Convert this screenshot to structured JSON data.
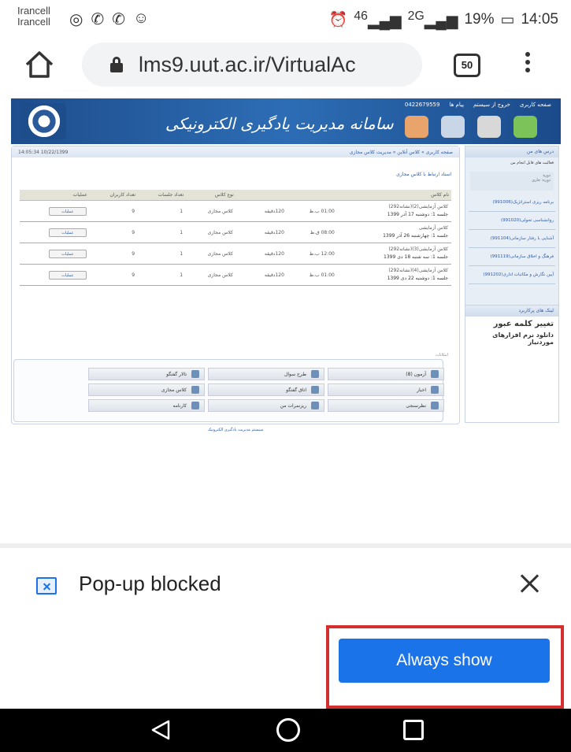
{
  "statusbar": {
    "carrier1": "Irancell",
    "carrier2": "Irancell",
    "signal1": "46",
    "signal2": "2G",
    "battery": "19%",
    "time": "14:05",
    "icons": [
      "instagram-icon",
      "whatsapp-icon",
      "viber-icon",
      "messenger-icon",
      "alarm-icon",
      "battery-icon"
    ]
  },
  "browser": {
    "url": "lms9.uut.ac.ir/VirtualAc",
    "tab_count": "50"
  },
  "site": {
    "banner_title": "سامانه مدیریت یادگیری الکترونیکی",
    "top_nav": [
      "صفحه کاربری",
      "خروج از سیستم",
      "پیام ها",
      "0422679559"
    ],
    "datetime": "14:05:34 10/22/1399",
    "breadcrumb": "صفحه کاربری » کلاس آنلاین » مدیریت کلاس مجازی",
    "related_link": "اسناد ارتباط با کلاس مجازی",
    "table": {
      "headers": [
        "نام کلاس",
        "",
        "",
        "",
        "نوع کلاس",
        "تعداد جلسات",
        "تعداد کاربران",
        "عملیات"
      ],
      "rows": [
        {
          "name": "کلاس آزمایشی(2)(نشانه292)",
          "session": "جلسه 1: دوشنبه 17 آذر 1399",
          "time": "01:00 ب.ظ",
          "duration": "120دقیقه",
          "type": "کلاس مجازی",
          "sessions": "1",
          "users": "9",
          "action": "عملیات"
        },
        {
          "name": "کلاس آزمایشی",
          "session": "جلسه 1: چهارشنبه 26 آذر 1399",
          "time": "08:00 ق.ظ",
          "duration": "120دقیقه",
          "type": "کلاس مجازی",
          "sessions": "1",
          "users": "9",
          "action": "عملیات"
        },
        {
          "name": "کلاس آزمایشی(3)(نشانه292)",
          "session": "جلسه 1: سه شنبه 18 دی 1399",
          "time": "12:00 ب.ظ",
          "duration": "120دقیقه",
          "type": "کلاس مجازی",
          "sessions": "1",
          "users": "9",
          "action": "عملیات"
        },
        {
          "name": "کلاس آزمایشی(4)(نشانه292)",
          "session": "جلسه 1: دوشنبه 22 دی 1399",
          "time": "01:00 ب.ظ",
          "duration": "120دقیقه",
          "type": "کلاس مجازی",
          "sessions": "1",
          "users": "9",
          "action": "عملیات"
        }
      ]
    },
    "tools_label": "امکانات",
    "tools": [
      "آزمون (8)",
      "طرح سوال",
      "تالار گفتگو",
      "اخبار",
      "اتاق گفتگو",
      "کلاس مجازی",
      "نظرسنجی",
      "ریزنمرات من",
      "کارنامه"
    ],
    "sidebar": {
      "title": "درس های من",
      "tool": "فعالیت های قابل انجام من",
      "select_label": "دوره",
      "select_value": "دوره: جاری",
      "courses": [
        "برنامه ریزی استراتژیک(991006)",
        "روانشناسی تحولی(991020)",
        "آشنایی با رفتار سازمانی(991104)",
        "فرهنگ و اخلاق سازمانی(991119)",
        "آیین نگارش و مکاتبات اداری(991202)"
      ]
    },
    "user_links": {
      "title": "لینک های پرکاربرد",
      "change_password": "تغییر کلمه عبور",
      "download": "دانلود نرم افزارهای موردنیاز"
    },
    "footer": "سیستم مدیریت یادگیری الکترونیک"
  },
  "popup": {
    "text": "Pop-up blocked",
    "button": "Always show"
  }
}
